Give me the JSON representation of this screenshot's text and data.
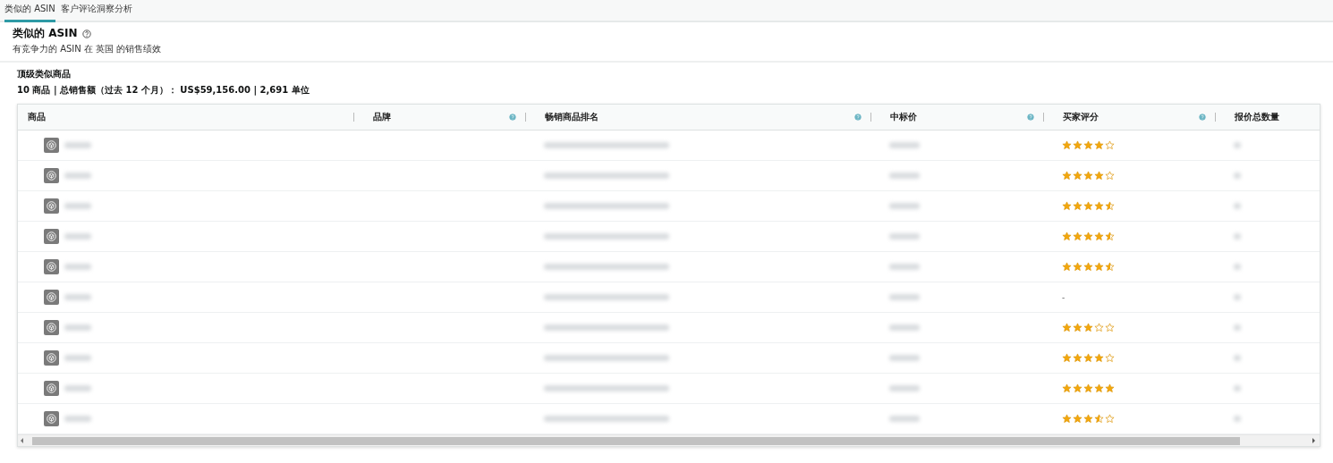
{
  "tabs": [
    {
      "label": "类似的 ASIN",
      "selected": true
    },
    {
      "label": "客户评论洞察分析",
      "selected": false
    }
  ],
  "header": {
    "title": "类似的 ASIN",
    "subtitle": "有竞争力的 ASIN 在 英国 的销售绩效"
  },
  "section": {
    "title": "顶级类似商品",
    "summary": "10 商品 | 总销售额（过去 12 个月）： US$59,156.00 | 2,691 单位"
  },
  "table": {
    "columns": [
      {
        "label": "商品",
        "help": false
      },
      {
        "label": "品牌",
        "help": true
      },
      {
        "label": "畅销商品排名",
        "help": true
      },
      {
        "label": "中标价",
        "help": true
      },
      {
        "label": "买家评分",
        "help": true
      },
      {
        "label": "报价总数量",
        "help": false
      }
    ],
    "rows": [
      {
        "stars": 4
      },
      {
        "stars": 4
      },
      {
        "stars": 4.5
      },
      {
        "stars": 4.5
      },
      {
        "stars": 4.5
      },
      {
        "rating": "-"
      },
      {
        "stars": 3
      },
      {
        "stars": 4
      },
      {
        "stars": 5
      },
      {
        "stars": 3.5
      }
    ]
  }
}
